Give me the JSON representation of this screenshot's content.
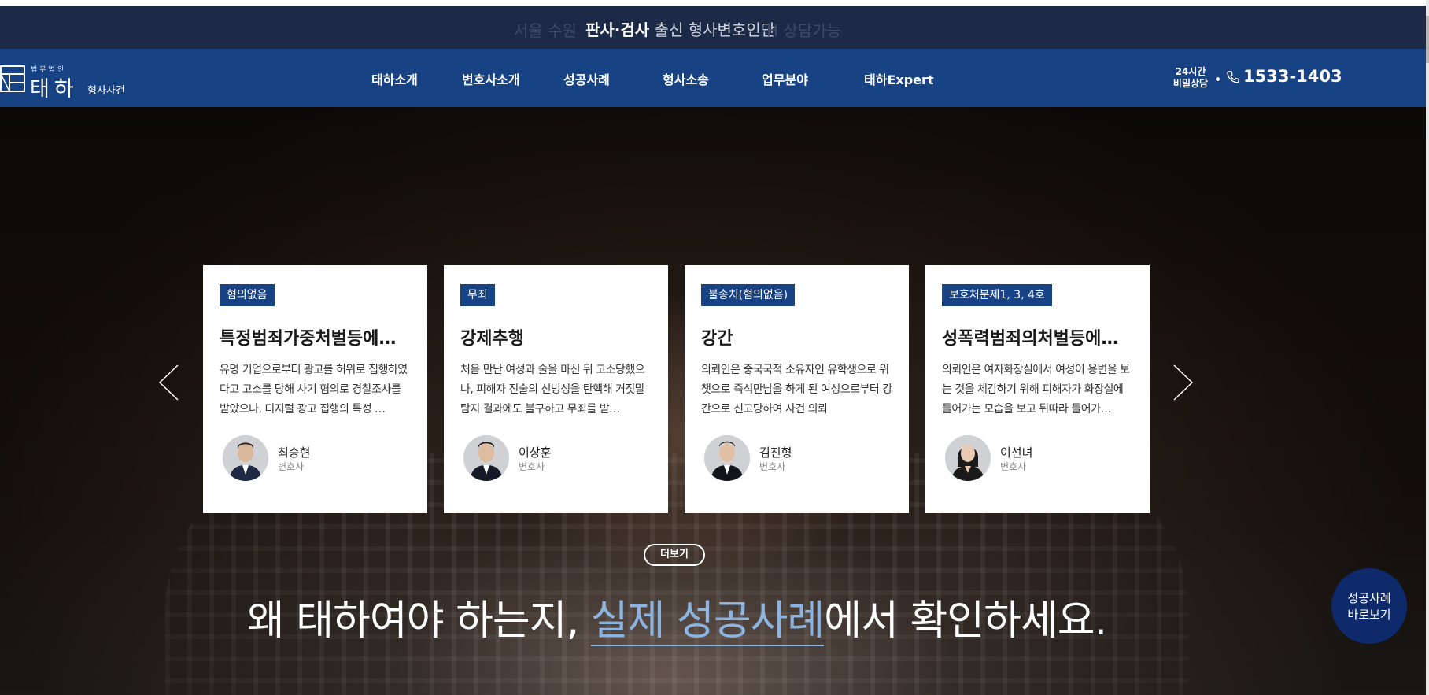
{
  "notice": {
    "ghost_left": "서울 수원",
    "ghost_right": "H 상담가능",
    "bold": "판사·검사",
    "rest": " 출신 형사변호인단"
  },
  "header": {
    "logo_small": "법무법인",
    "logo_name": "태하",
    "logo_sub": "형사사건",
    "nav": [
      "태하소개",
      "변호사소개",
      "성공사례",
      "형사소송",
      "업무분야",
      "태하Expert"
    ],
    "phone_label_1": "24시간",
    "phone_label_2": "비밀상담",
    "phone_number": "1533-1403"
  },
  "cards": [
    {
      "badge": "혐의없음",
      "title": "특정범죄가중처벌등에…",
      "desc": "유명 기업으로부터 광고를 허위로 집행하였다고 고소를 당해 사기 혐의로 경찰조사를 받았으나, 디지털 광고 집행의 특성 …",
      "lawyer_name": "최승현",
      "lawyer_role": "변호사"
    },
    {
      "badge": "무죄",
      "title": "강제추행",
      "desc": "처음 만난 여성과 술을 마신 뒤 고소당했으나, 피해자 진술의 신빙성을 탄핵해 거짓말탐지 결과에도 불구하고 무죄를 받…",
      "lawyer_name": "이상훈",
      "lawyer_role": "변호사"
    },
    {
      "badge": "불송치(혐의없음)",
      "title": "강간",
      "desc": "의뢰인은 중국국적 소유자인 유학생으로 위챗으로 즉석만남을 하게 된 여성으로부터 강간으로 신고당하여 사건 의뢰",
      "lawyer_name": "김진형",
      "lawyer_role": "변호사"
    },
    {
      "badge": "보호처분제1, 3, 4호",
      "title": "성폭력범죄의처벌등에…",
      "desc": "의뢰인은 여자화장실에서 여성이 용변을 보는 것을 체감하기 위해 피해자가 화장실에 들어가는 모습을 보고 뒤따라 들어가…",
      "lawyer_name": "이선녀",
      "lawyer_role": "변호사"
    }
  ],
  "hero": {
    "more_label": "더보기",
    "headline_pre": "왜 태하여야 하는지, ",
    "headline_highlight": "실제 성공사례",
    "headline_post": "에서 확인하세요."
  },
  "float_button": {
    "line1": "성공사례",
    "line2": "바로보기"
  },
  "colors": {
    "topbar": "#1c2947",
    "header": "#174283",
    "badge": "#174283",
    "highlight": "#8db4e0",
    "float_button": "#0e2a6a"
  },
  "icons": {
    "phone": "phone-icon",
    "prev": "chevron-left-icon",
    "next": "chevron-right-icon"
  }
}
